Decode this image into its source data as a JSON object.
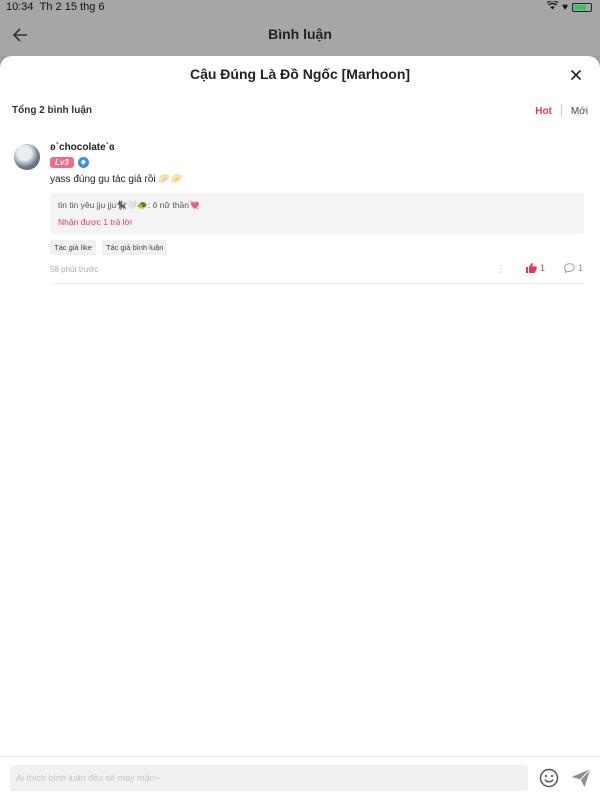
{
  "status_bar": {
    "time": "10:34",
    "date": "Th 2 15 thg 6"
  },
  "top_nav": {
    "title": "Bình luận"
  },
  "sheet": {
    "title": "Cậu Đúng Là Đồ Ngốc [Marhoon]",
    "total_label": "Tổng 2 bình luận",
    "sort": {
      "hot": "Hot",
      "new": "Mới"
    }
  },
  "comment": {
    "username": "ʚ`chocolate`ɞ",
    "level": "Lv3",
    "text": "yass đúng gu tác giả rồi 🥟🥟",
    "reply_preview": "tin tin yêu jju jju🐈‍⬛🤍🐢: ô nữ thần💘",
    "reply_count_label": "Nhận được 1 trả lời",
    "tags": [
      "Tác giả like",
      "Tác giả bình luận"
    ],
    "time": "58 phút trước",
    "likes": "1",
    "replies": "1"
  },
  "input": {
    "placeholder": "Ai thích bình luận đều sẽ may mắn~"
  },
  "colors": {
    "accent": "#e9375a",
    "level_badge": "#f06a8a",
    "shield": "#3d8ce0"
  }
}
